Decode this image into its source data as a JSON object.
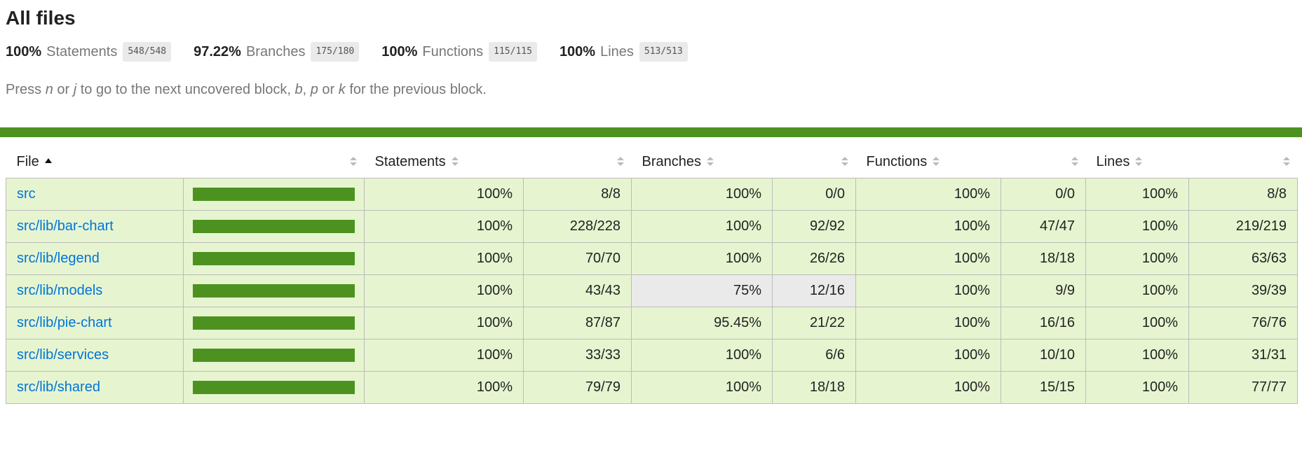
{
  "title": "All files",
  "summary": [
    {
      "pct": "100%",
      "label": "Statements",
      "fraction": "548/548"
    },
    {
      "pct": "97.22%",
      "label": "Branches",
      "fraction": "175/180"
    },
    {
      "pct": "100%",
      "label": "Functions",
      "fraction": "115/115"
    },
    {
      "pct": "100%",
      "label": "Lines",
      "fraction": "513/513"
    }
  ],
  "hint": {
    "part1": "Press ",
    "key_n": "n",
    "part2": " or ",
    "key_j": "j",
    "part3": " to go to the next uncovered block, ",
    "key_b": "b",
    "part4": ", ",
    "key_p": "p",
    "part5": " or ",
    "key_k": "k",
    "part6": " for the previous block."
  },
  "status_color": "#4d9221",
  "columns": {
    "file": "File",
    "statements": "Statements",
    "branches": "Branches",
    "functions": "Functions",
    "lines": "Lines"
  },
  "rows": [
    {
      "file": "src",
      "coverage": 100,
      "stmt_pct": "100%",
      "stmt": "8/8",
      "br_pct": "100%",
      "br": "0/0",
      "fn_pct": "100%",
      "fn": "0/0",
      "ln_pct": "100%",
      "ln": "8/8"
    },
    {
      "file": "src/lib/bar-chart",
      "coverage": 100,
      "stmt_pct": "100%",
      "stmt": "228/228",
      "br_pct": "100%",
      "br": "92/92",
      "fn_pct": "100%",
      "fn": "47/47",
      "ln_pct": "100%",
      "ln": "219/219"
    },
    {
      "file": "src/lib/legend",
      "coverage": 100,
      "stmt_pct": "100%",
      "stmt": "70/70",
      "br_pct": "100%",
      "br": "26/26",
      "fn_pct": "100%",
      "fn": "18/18",
      "ln_pct": "100%",
      "ln": "63/63"
    },
    {
      "file": "src/lib/models",
      "coverage": 100,
      "stmt_pct": "100%",
      "stmt": "43/43",
      "br_pct": "75%",
      "br": "12/16",
      "fn_pct": "100%",
      "fn": "9/9",
      "ln_pct": "100%",
      "ln": "39/39"
    },
    {
      "file": "src/lib/pie-chart",
      "coverage": 100,
      "stmt_pct": "100%",
      "stmt": "87/87",
      "br_pct": "95.45%",
      "br": "21/22",
      "fn_pct": "100%",
      "fn": "16/16",
      "ln_pct": "100%",
      "ln": "76/76"
    },
    {
      "file": "src/lib/services",
      "coverage": 100,
      "stmt_pct": "100%",
      "stmt": "33/33",
      "br_pct": "100%",
      "br": "6/6",
      "fn_pct": "100%",
      "fn": "10/10",
      "ln_pct": "100%",
      "ln": "31/31"
    },
    {
      "file": "src/lib/shared",
      "coverage": 100,
      "stmt_pct": "100%",
      "stmt": "79/79",
      "br_pct": "100%",
      "br": "18/18",
      "fn_pct": "100%",
      "fn": "15/15",
      "ln_pct": "100%",
      "ln": "77/77"
    }
  ]
}
